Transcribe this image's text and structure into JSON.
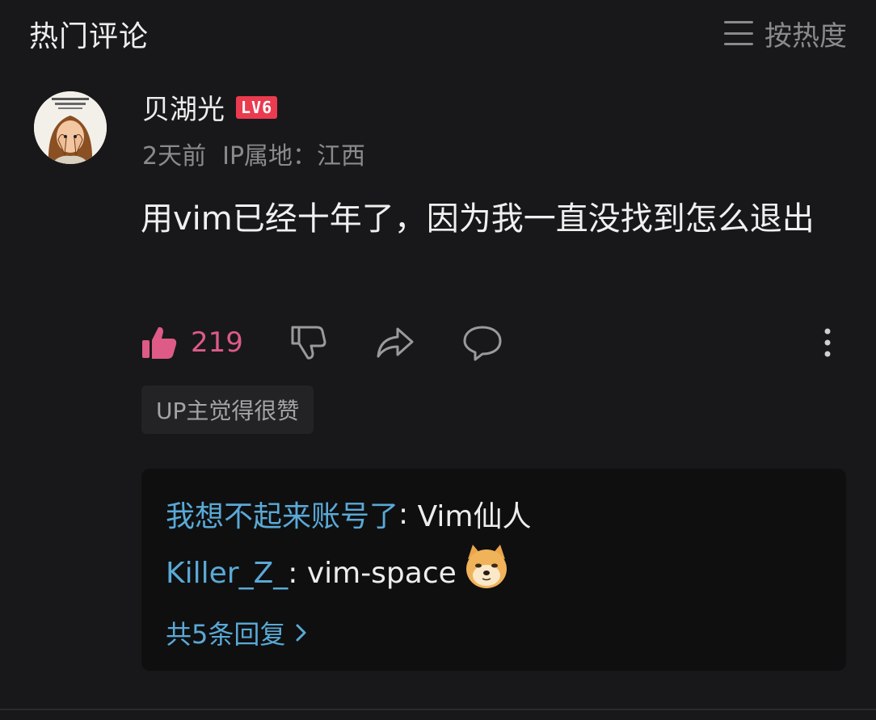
{
  "header": {
    "title": "热门评论",
    "sort_label": "按热度",
    "sort_icon": "menu-lines-icon"
  },
  "comment": {
    "username": "贝湖光",
    "level": "LV6",
    "time": "2天前",
    "ip_location": "IP属地：江西",
    "text": "用vim已经十年了，因为我一直没找到怎么退出",
    "likes": "219",
    "like_color": "#dd5b86",
    "up_tag": "UP主觉得很赞"
  },
  "replies": {
    "items": [
      {
        "author": "我想不起来账号了",
        "separator": ": ",
        "text": "Vim仙人",
        "emoji": ""
      },
      {
        "author": "Killer_Z_",
        "separator": ": ",
        "text": "vim-space",
        "emoji": "doge-emoji"
      }
    ],
    "total_label": "共5条回复"
  },
  "colors": {
    "background": "#18181a",
    "accent_blue": "#5aa9d6",
    "level_red": "#ea3b4f"
  }
}
